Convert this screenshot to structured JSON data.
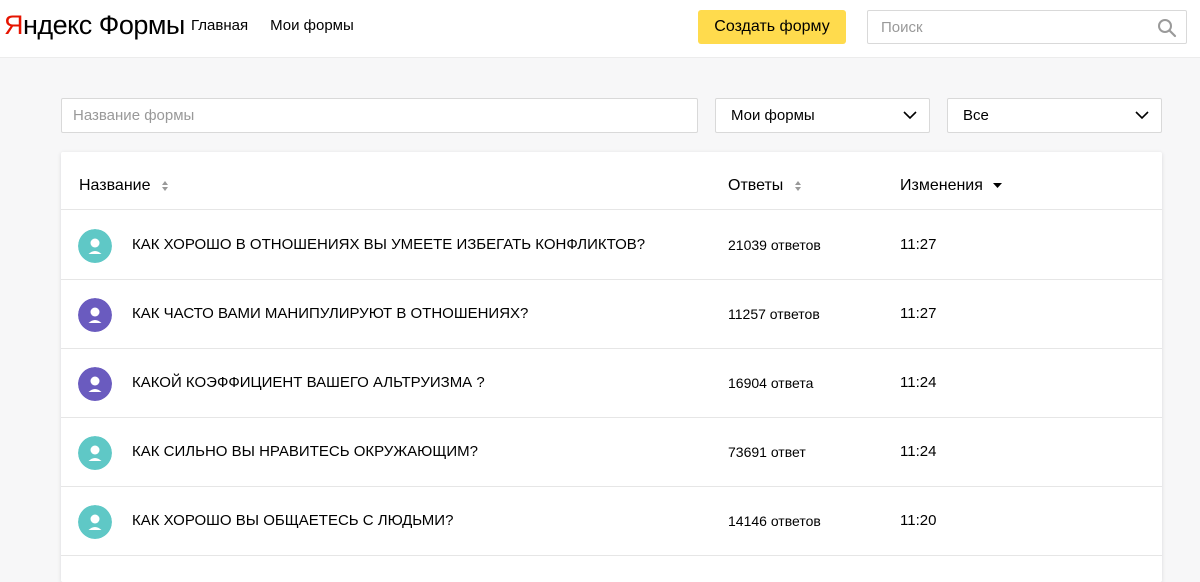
{
  "header": {
    "logo_first": "Я",
    "logo_rest": "ндекс Формы",
    "nav": [
      {
        "label": "Главная"
      },
      {
        "label": "Мои формы"
      }
    ],
    "create_label": "Создать форму",
    "search_placeholder": "Поиск"
  },
  "filters": {
    "name_placeholder": "Название формы",
    "owner_value": "Мои формы",
    "status_value": "Все"
  },
  "table": {
    "columns": {
      "name": "Название",
      "answers": "Ответы",
      "changes": "Изменения"
    },
    "rows": [
      {
        "title": "КАК ХОРОШО В ОТНОШЕНИЯХ ВЫ УМЕЕТЕ ИЗБЕГАТЬ КОНФЛИКТОВ?",
        "answers": "21039 ответов",
        "time": "11:27",
        "avatar_color": "#5fc8c6",
        "icon": "user-icon"
      },
      {
        "title": "КАК ЧАСТО ВАМИ МАНИПУЛИРУЮТ В ОТНОШЕНИЯХ?",
        "answers": "11257 ответов",
        "time": "11:27",
        "avatar_color": "#6a5bbf",
        "icon": "user-icon"
      },
      {
        "title": "КАКОЙ КОЭФФИЦИЕНТ ВАШЕГО АЛЬТРУИЗМА ?",
        "answers": "16904 ответа",
        "time": "11:24",
        "avatar_color": "#6a5bbf",
        "icon": "user-icon"
      },
      {
        "title": "КАК СИЛЬНО ВЫ НРАВИТЕСЬ ОКРУЖАЮЩИМ?",
        "answers": "73691 ответ",
        "time": "11:24",
        "avatar_color": "#5fc8c6",
        "icon": "user-icon"
      },
      {
        "title": "КАК ХОРОШО ВЫ ОБЩАЕТЕСЬ С ЛЮДЬМИ?",
        "answers": "14146 ответов",
        "time": "11:20",
        "avatar_color": "#5fc8c6",
        "icon": "user-icon"
      }
    ]
  },
  "colors": {
    "brand_red": "#e61400",
    "accent_yellow": "#ffdb4d"
  }
}
